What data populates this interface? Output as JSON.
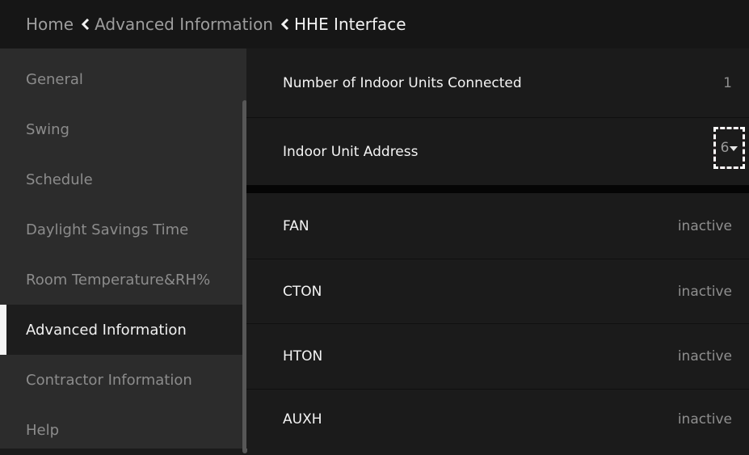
{
  "breadcrumb": {
    "home": "Home",
    "parent": "Advanced Information",
    "current": "HHE Interface"
  },
  "sidebar": {
    "items": [
      {
        "label": "General"
      },
      {
        "label": "Swing"
      },
      {
        "label": "Schedule"
      },
      {
        "label": "Daylight Savings Time"
      },
      {
        "label": "Room Temperature&RH%"
      },
      {
        "label": "Advanced Information",
        "active": true
      },
      {
        "label": "Contractor Information"
      },
      {
        "label": "Help"
      }
    ]
  },
  "main": {
    "units_connected": {
      "label": "Number of Indoor Units Connected",
      "value": "1"
    },
    "indoor_address": {
      "label": "Indoor Unit Address",
      "value": "6"
    },
    "signals": [
      {
        "label": "FAN",
        "value": "inactive"
      },
      {
        "label": "CTON",
        "value": "inactive"
      },
      {
        "label": "HTON",
        "value": "inactive"
      },
      {
        "label": "AUXH",
        "value": "inactive"
      }
    ]
  },
  "colors": {
    "background": "#1b1b1b",
    "sidebar": "#2c2c2c",
    "header": "#161616",
    "highlight_red": "#c0213a"
  },
  "icons": [
    "chevron-left-icon",
    "dropdown-caret-icon"
  ]
}
